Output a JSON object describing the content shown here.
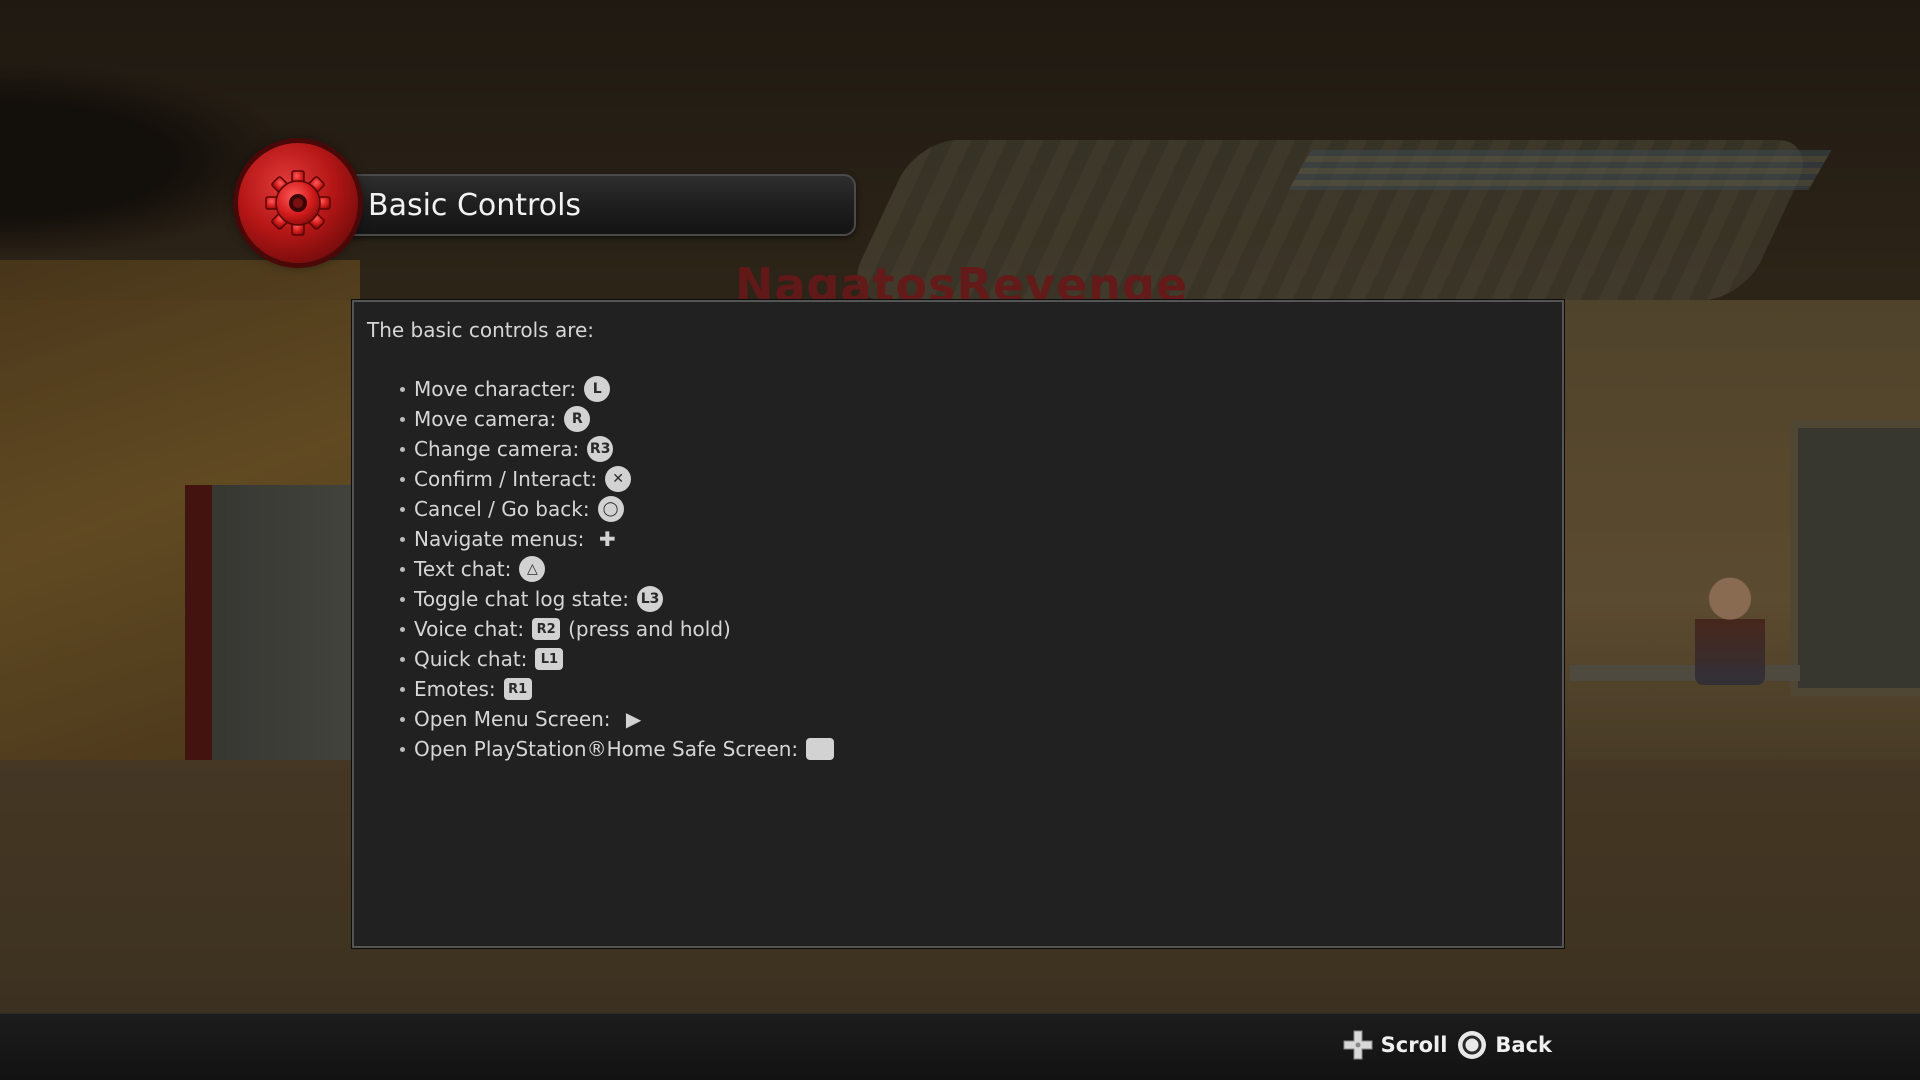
{
  "scene": {
    "sign_text": "NagatosRevenge"
  },
  "header": {
    "title": "Basic Controls",
    "badge_icon": "gear-icon",
    "badge_color": "#c41a1a"
  },
  "panel": {
    "intro": "The basic controls are:",
    "controls": [
      {
        "label": "Move character:",
        "glyph": "L",
        "glyph_shape": "round"
      },
      {
        "label": "Move camera:",
        "glyph": "R",
        "glyph_shape": "round"
      },
      {
        "label": "Change camera:",
        "glyph": "R3",
        "glyph_shape": "round"
      },
      {
        "label": "Confirm / Interact:",
        "glyph": "✕",
        "glyph_shape": "round"
      },
      {
        "label": "Cancel / Go back:",
        "glyph": "◯",
        "glyph_shape": "round"
      },
      {
        "label": "Navigate menus:",
        "glyph": "✚",
        "glyph_shape": "plain"
      },
      {
        "label": "Text chat:",
        "glyph": "△",
        "glyph_shape": "round"
      },
      {
        "label": "Toggle chat log state:",
        "glyph": "L3",
        "glyph_shape": "round"
      },
      {
        "label": "Voice chat:",
        "glyph": "R2",
        "glyph_shape": "rect",
        "extra": "(press and hold)"
      },
      {
        "label": "Quick chat:",
        "glyph": "L1",
        "glyph_shape": "rect"
      },
      {
        "label": "Emotes:",
        "glyph": "R1",
        "glyph_shape": "rect"
      },
      {
        "label": "Open Menu Screen:",
        "glyph": "▶",
        "glyph_shape": "plain"
      },
      {
        "label": "Open PlayStation®Home Safe Screen:",
        "glyph": "",
        "glyph_shape": "rect"
      }
    ]
  },
  "footer": {
    "scroll_label": "Scroll",
    "scroll_icon": "dpad-icon",
    "back_label": "Back",
    "back_icon": "circle-button-icon"
  }
}
